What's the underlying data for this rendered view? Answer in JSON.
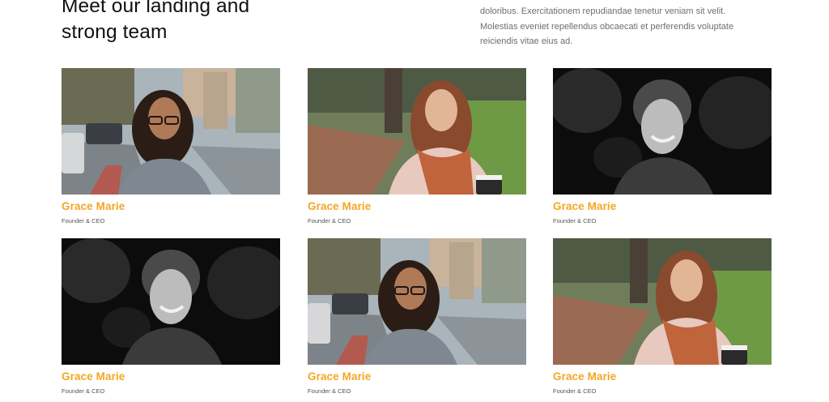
{
  "section": {
    "heading_line1": "Meet our landing and",
    "heading_line2": "strong team",
    "intro_line1": "doloribus. Exercitationem repudiandae tenetur veniam sit velit.",
    "intro_line2": "Molestias eveniet repellendus obcaecati et perferendis voluptate",
    "intro_line3": "reiciendis vitae eius ad."
  },
  "team": [
    {
      "name": "Grace Marie",
      "role": "Founder & CEO",
      "photo": "woman-glasses-street-photo"
    },
    {
      "name": "Grace Marie",
      "role": "Founder & CEO",
      "photo": "woman-scarf-park-photo"
    },
    {
      "name": "Grace Marie",
      "role": "Founder & CEO",
      "photo": "man-curly-hair-bw-photo"
    },
    {
      "name": "Grace Marie",
      "role": "Founder & CEO",
      "photo": "man-curly-hair-bw-photo"
    },
    {
      "name": "Grace Marie",
      "role": "Founder & CEO",
      "photo": "woman-glasses-street-photo"
    },
    {
      "name": "Grace Marie",
      "role": "Founder & CEO",
      "photo": "woman-scarf-park-photo"
    }
  ],
  "colors": {
    "accent": "#f5a623",
    "heading": "#111111",
    "body_text": "#6e6e6e"
  }
}
